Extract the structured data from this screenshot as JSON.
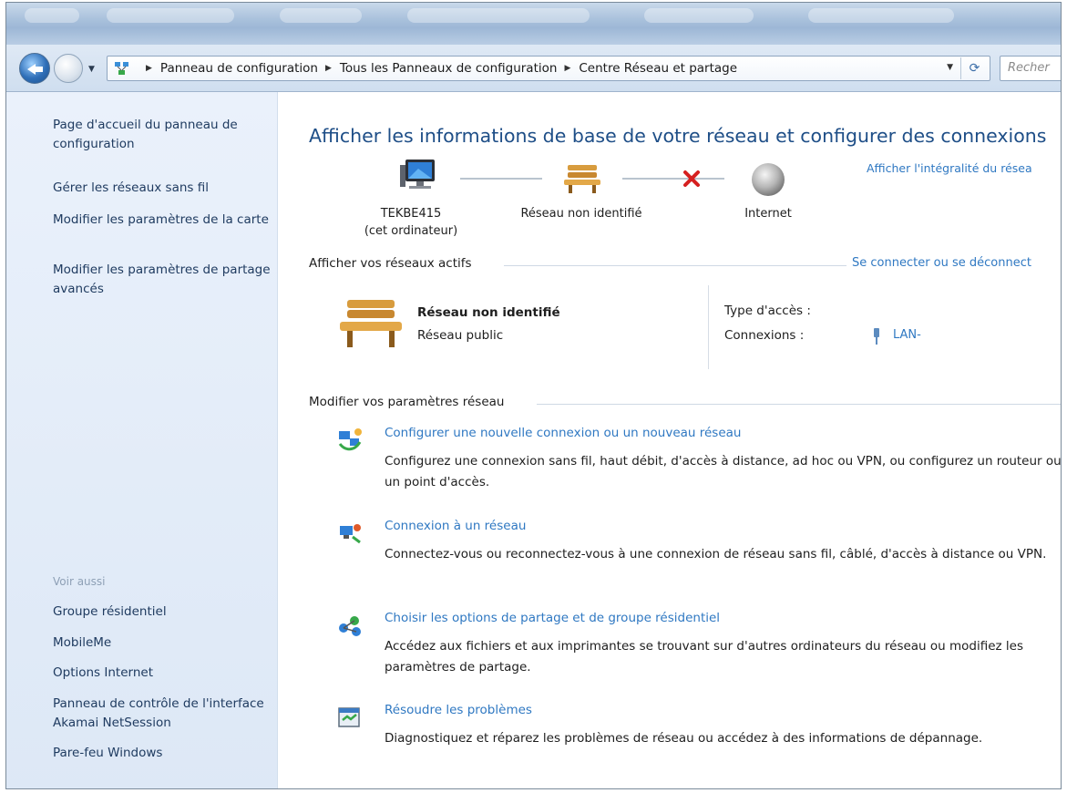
{
  "navigation": {
    "breadcrumbs": [
      "Panneau de configuration",
      "Tous les Panneaux de configuration",
      "Centre Réseau et partage"
    ],
    "search_placeholder": "Recher"
  },
  "left_pane": {
    "tasks": [
      "Page d'accueil du panneau de configuration",
      "Gérer les réseaux sans fil",
      "Modifier les paramètres de la carte",
      "Modifier les paramètres de partage avancés"
    ],
    "see_also_label": "Voir aussi",
    "see_also": [
      "Groupe résidentiel",
      "MobileMe",
      "Options Internet",
      "Panneau de contrôle de l'interface Akamai NetSession",
      "Pare-feu Windows"
    ]
  },
  "main": {
    "title": "Afficher les informations de base de votre réseau et configurer des connexions",
    "full_map_link": "Afficher l'intégralité du résea",
    "map": {
      "computer_name": "TEKBE415",
      "computer_sub": "(cet ordinateur)",
      "network_name": "Réseau non identifié",
      "internet_label": "Internet"
    },
    "active_networks": {
      "heading": "Afficher vos réseaux actifs",
      "connect_link": "Se connecter ou se déconnect",
      "network_name": "Réseau non identifié",
      "network_type": "Réseau public",
      "access_type_label": "Type d'accès :",
      "connections_label": "Connexions :",
      "connection_value": "LAN-"
    },
    "change_settings": {
      "heading": "Modifier vos paramètres réseau",
      "tasks": [
        {
          "title": "Configurer une nouvelle connexion ou un nouveau réseau",
          "description": "Configurez une connexion sans fil, haut débit, d'accès à distance, ad hoc ou VPN, ou configurez un routeur ou un point d'accès.",
          "icon": "new-connection-icon"
        },
        {
          "title": "Connexion à un réseau",
          "description": "Connectez-vous ou reconnectez-vous à une connexion de réseau sans fil, câblé, d'accès à distance ou VPN.",
          "icon": "connect-network-icon"
        },
        {
          "title": "Choisir les options de partage et de groupe résidentiel",
          "description": "Accédez aux fichiers et aux imprimantes se trouvant sur d'autres ordinateurs du réseau ou modifiez les paramètres de partage.",
          "icon": "homegroup-icon"
        },
        {
          "title": "Résoudre les problèmes",
          "description": "Diagnostiquez et réparez les problèmes de réseau ou accédez à des informations de dépannage.",
          "icon": "troubleshoot-icon"
        }
      ]
    }
  },
  "colors": {
    "link": "#2f78c2",
    "title": "#1e4e87",
    "left_pane_bg": "#e3ecf8",
    "error_x": "#d62020"
  }
}
